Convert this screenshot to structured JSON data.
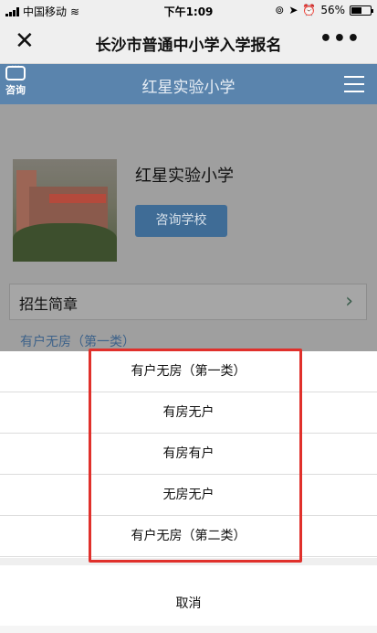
{
  "status_bar": {
    "carrier": "中国移动",
    "time": "下午1:09",
    "battery": "56%",
    "battery_level": 0.56
  },
  "nav": {
    "close_icon": "close-icon",
    "title": "长沙市普通中小学入学报名",
    "more_icon": "more-dots-icon"
  },
  "header": {
    "consult_label": "咨询",
    "title": "红星实验小学",
    "menu_icon": "hamburger-menu-icon"
  },
  "school": {
    "name": "红星实验小学",
    "consult_button": "咨询学校"
  },
  "section": {
    "title": "招生简章",
    "chevron_icon": "chevron-right-icon"
  },
  "selected_type": "有户无房（第一类）",
  "action_sheet": {
    "options": [
      "有户无房（第一类）",
      "有房无户",
      "有房有户",
      "无房无户",
      "有户无房（第二类）"
    ],
    "cancel": "取消"
  },
  "colors": {
    "header_bg": "#5a84ad",
    "button_bg": "#3f6c96",
    "highlight": "#e0302b"
  }
}
